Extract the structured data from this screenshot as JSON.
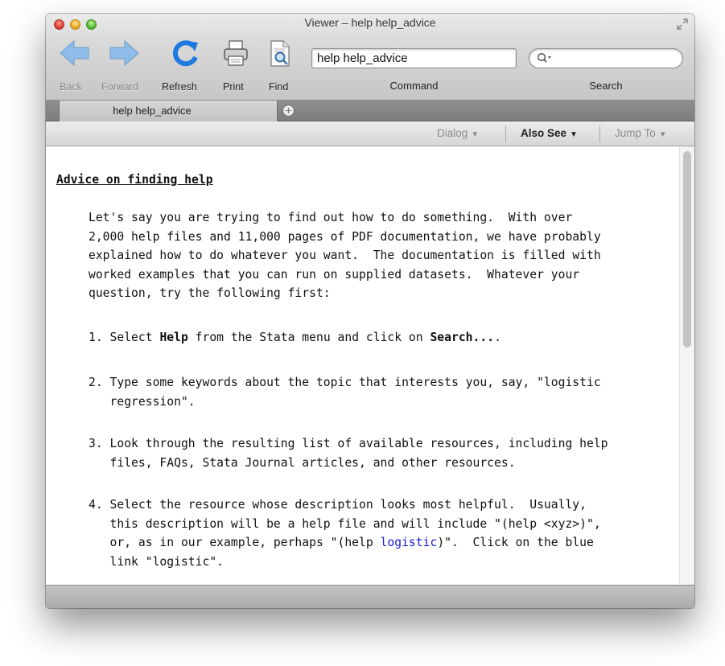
{
  "window": {
    "title": "Viewer – help help_advice"
  },
  "toolbar": {
    "back_label": "Back",
    "forward_label": "Forward",
    "refresh_label": "Refresh",
    "print_label": "Print",
    "find_label": "Find",
    "command_value": "help help_advice",
    "command_label": "Command",
    "search_value": "",
    "search_label": "Search"
  },
  "tabs": [
    {
      "label": "help help_advice"
    }
  ],
  "subtoolbar": {
    "dialog": "Dialog",
    "also_see": "Also See",
    "jump_to": "Jump To",
    "caret": "▼"
  },
  "content": {
    "heading": "Advice on finding help",
    "intro": [
      "Let's say you are trying to find out how to do something.  With over",
      "2,000 help files and 11,000 pages of PDF documentation, we have probably",
      "explained how to do whatever you want.  The documentation is filled with",
      "worked examples that you can run on supplied datasets.  Whatever your",
      "question, try the following first:"
    ],
    "step1": {
      "pre": "1. Select ",
      "b1": "Help",
      "mid": " from the Stata menu and click on ",
      "b2": "Search...",
      "post": "."
    },
    "step2": {
      "line1": "2. Type some keywords about the topic that interests you, say, \"logistic",
      "line2": "   regression\"."
    },
    "step3": {
      "line1": "3. Look through the resulting list of available resources, including help",
      "line2": "   files, FAQs, Stata Journal articles, and other resources."
    },
    "step4": {
      "line1": "4. Select the resource whose description looks most helpful.  Usually,",
      "line2": "   this description will be a help file and will include \"(help <xyz>)\",",
      "line3_pre": "   or, as in our example, perhaps \"(help ",
      "line3_link": "logistic",
      "line3_post": ")\".  Click on the blue",
      "line4": "   link \"logistic\"."
    }
  },
  "colors": {
    "link": "#1a1ad6",
    "nav_arrow": "#7fb0e3",
    "refresh": "#1f7ae0"
  }
}
